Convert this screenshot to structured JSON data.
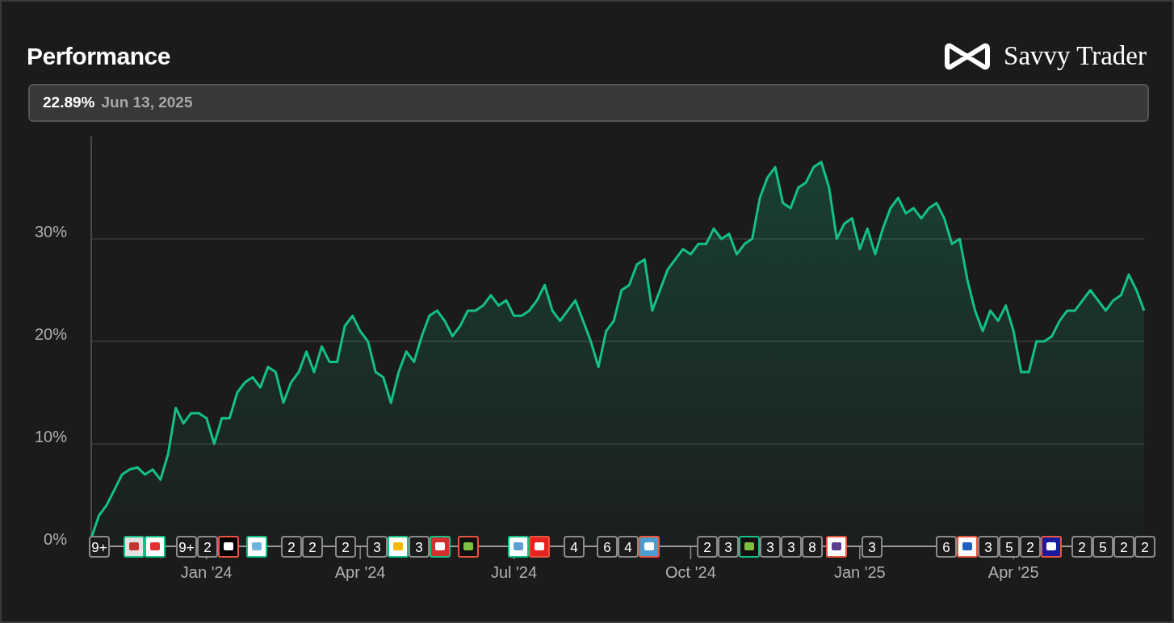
{
  "header": {
    "title": "Performance",
    "brand": "Savvy Trader"
  },
  "summary": {
    "value": "22.89%",
    "date": "Jun 13, 2025"
  },
  "chart": {
    "chart_data": {
      "type": "area",
      "grid": true,
      "ylim": [
        0,
        40
      ],
      "yticks": [
        {
          "value": 0,
          "label": "0%"
        },
        {
          "value": 10,
          "label": "10%"
        },
        {
          "value": 20,
          "label": "20%"
        },
        {
          "value": 30,
          "label": "30%"
        }
      ],
      "categories": [
        null,
        null,
        null,
        null,
        null,
        null,
        null,
        null,
        null,
        null,
        null,
        null,
        null,
        null,
        null,
        "Jan '24",
        null,
        null,
        null,
        null,
        null,
        null,
        null,
        null,
        null,
        null,
        null,
        null,
        null,
        null,
        null,
        null,
        null,
        null,
        null,
        "Apr '24",
        null,
        null,
        null,
        null,
        null,
        null,
        null,
        null,
        null,
        null,
        null,
        null,
        null,
        null,
        null,
        null,
        null,
        null,
        null,
        "Jul '24",
        null,
        null,
        null,
        null,
        null,
        null,
        null,
        null,
        null,
        null,
        null,
        null,
        null,
        null,
        null,
        null,
        null,
        null,
        null,
        null,
        null,
        null,
        "Oct '24",
        null,
        null,
        null,
        null,
        null,
        null,
        null,
        null,
        null,
        null,
        null,
        null,
        null,
        null,
        null,
        null,
        null,
        null,
        null,
        null,
        null,
        "Jan '25",
        null,
        null,
        null,
        null,
        null,
        null,
        null,
        null,
        null,
        null,
        null,
        null,
        null,
        null,
        null,
        null,
        null,
        null,
        null,
        "Apr '25",
        null,
        null,
        null,
        null,
        null,
        null,
        null,
        null,
        null,
        null,
        null,
        null,
        null,
        null,
        null,
        null,
        null
      ],
      "series": [
        {
          "color": "#14c184",
          "values": [
            0.8,
            3,
            4,
            5.5,
            7,
            7.5,
            7.7,
            7,
            7.5,
            6.5,
            9,
            13.5,
            12,
            13,
            13,
            12.5,
            10,
            12.5,
            12.5,
            15,
            16,
            16.5,
            15.5,
            17.5,
            17,
            14,
            16,
            17,
            19,
            17,
            19.5,
            18,
            18,
            21.5,
            22.5,
            21,
            20,
            17,
            16.5,
            14,
            17,
            19,
            18,
            20.5,
            22.5,
            23,
            22,
            20.5,
            21.5,
            23,
            23,
            23.5,
            24.5,
            23.5,
            24,
            22.5,
            22.5,
            23,
            24,
            25.5,
            23,
            22,
            23,
            24,
            22,
            20,
            17.5,
            21,
            22,
            25,
            25.5,
            27.5,
            28,
            23,
            25,
            27,
            28,
            29,
            28.5,
            29.5,
            29.5,
            31,
            30,
            30.5,
            28.5,
            29.5,
            30,
            34,
            36,
            37,
            33.5,
            33,
            35,
            35.5,
            37,
            37.5,
            35,
            30,
            31.5,
            32,
            29,
            31,
            28.5,
            31,
            33,
            34,
            32.5,
            33,
            32,
            33,
            33.5,
            32,
            29.5,
            30,
            26,
            23,
            21,
            23,
            22,
            23.5,
            21,
            17,
            17,
            20,
            20,
            20.5,
            22,
            23,
            23,
            24,
            25,
            24,
            23,
            24,
            24.5,
            26.5,
            25,
            23
          ]
        }
      ]
    }
  },
  "markers": [
    {
      "items": [
        {
          "kind": "count",
          "text": "9+"
        }
      ]
    },
    {
      "items": [
        {
          "kind": "logo",
          "color": "#14c184"
        },
        {
          "kind": "logo",
          "color": "#14c184"
        }
      ]
    },
    {
      "items": [
        {
          "kind": "count",
          "text": "9+"
        },
        {
          "kind": "count",
          "text": "2"
        },
        {
          "kind": "logo",
          "color": "#e8553f"
        }
      ]
    },
    {
      "items": [
        {
          "kind": "logo",
          "color": "#14c184"
        }
      ]
    },
    {
      "items": [
        {
          "kind": "count",
          "text": "2"
        },
        {
          "kind": "count",
          "text": "2"
        }
      ]
    },
    {
      "items": [
        {
          "kind": "count",
          "text": "2"
        }
      ]
    },
    {
      "items": [
        {
          "kind": "count",
          "text": "3"
        },
        {
          "kind": "logo",
          "color": "#14c184"
        },
        {
          "kind": "count",
          "text": "3"
        },
        {
          "kind": "logo",
          "color": "#14c184"
        }
      ]
    },
    {
      "items": [
        {
          "kind": "logo",
          "color": "#e8553f"
        }
      ]
    },
    {
      "items": [
        {
          "kind": "logo",
          "color": "#14c184"
        },
        {
          "kind": "logo",
          "color": "#e8553f"
        }
      ]
    },
    {
      "items": [
        {
          "kind": "count",
          "text": "4"
        }
      ]
    },
    {
      "items": [
        {
          "kind": "count",
          "text": "6"
        },
        {
          "kind": "count",
          "text": "4"
        },
        {
          "kind": "logo",
          "color": "#e8553f"
        }
      ]
    },
    {
      "items": [
        {
          "kind": "count",
          "text": "2"
        },
        {
          "kind": "count",
          "text": "3"
        },
        {
          "kind": "logo",
          "color": "#14c184"
        },
        {
          "kind": "count",
          "text": "3"
        },
        {
          "kind": "count",
          "text": "3"
        },
        {
          "kind": "count",
          "text": "8"
        }
      ]
    },
    {
      "items": [
        {
          "kind": "logo",
          "color": "#e8553f"
        }
      ]
    },
    {
      "items": [
        {
          "kind": "count",
          "text": "3"
        }
      ]
    },
    {
      "items": [
        {
          "kind": "count",
          "text": "6"
        },
        {
          "kind": "logo",
          "color": "#e8553f"
        },
        {
          "kind": "count",
          "text": "3"
        },
        {
          "kind": "count",
          "text": "5"
        },
        {
          "kind": "count",
          "text": "2"
        },
        {
          "kind": "logo",
          "color": "#e8553f"
        }
      ]
    },
    {
      "items": [
        {
          "kind": "count",
          "text": "2"
        },
        {
          "kind": "count",
          "text": "5"
        },
        {
          "kind": "count",
          "text": "2"
        },
        {
          "kind": "count",
          "text": "2"
        }
      ]
    }
  ]
}
